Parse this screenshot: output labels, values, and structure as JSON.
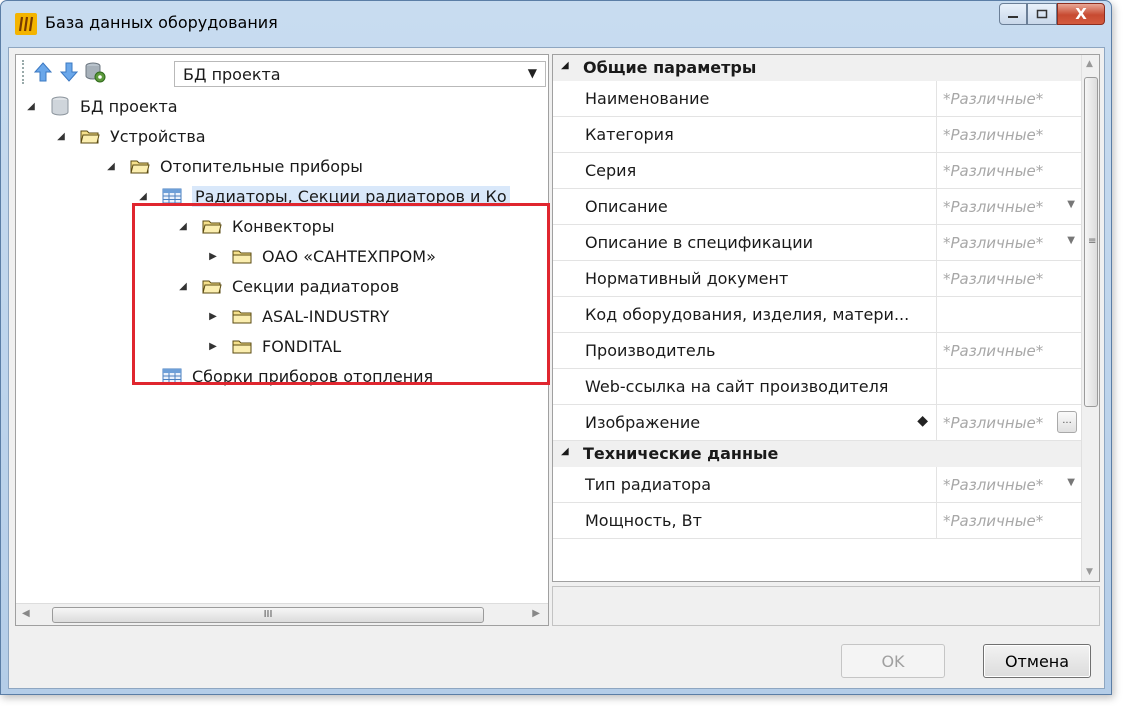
{
  "window": {
    "title": "База данных оборудования",
    "controls": {
      "minimize": "—",
      "maximize": "▢",
      "close": "X"
    }
  },
  "toolbar": {
    "icons": [
      "arrow-up-icon",
      "arrow-down-icon",
      "database-settings-icon"
    ],
    "source_combo": "БД проекта"
  },
  "tree": {
    "nodes": [
      {
        "label": "БД проекта",
        "icon": "database-icon",
        "expanded": true
      },
      {
        "label": "Устройства",
        "icon": "folder-open-icon",
        "expanded": true
      },
      {
        "label": "Отопительные приборы",
        "icon": "folder-open-icon",
        "expanded": true
      },
      {
        "label": "Радиаторы, Секции радиаторов и Ко",
        "icon": "table-icon",
        "expanded": true,
        "selected": true
      },
      {
        "label": "Конвекторы",
        "icon": "folder-open-icon",
        "expanded": true
      },
      {
        "label": "ОАО «САНТЕХПРОМ»",
        "icon": "folder-icon",
        "expanded": false
      },
      {
        "label": "Секции радиаторов",
        "icon": "folder-open-icon",
        "expanded": true
      },
      {
        "label": "ASAL-INDUSTRY",
        "icon": "folder-icon",
        "expanded": false
      },
      {
        "label": "FONDITAL",
        "icon": "folder-icon",
        "expanded": false
      },
      {
        "label": "Сборки приборов отопления",
        "icon": "table-icon",
        "expanded": false
      }
    ],
    "scroll_grip": "III"
  },
  "properties": {
    "categories": [
      {
        "label": "Общие параметры",
        "rows": [
          {
            "name": "Наименование",
            "value": "*Различные*"
          },
          {
            "name": "Категория",
            "value": "*Различные*"
          },
          {
            "name": "Серия",
            "value": "*Различные*"
          },
          {
            "name": "Описание",
            "value": "*Различные*",
            "dropdown": true
          },
          {
            "name": "Описание в спецификации",
            "value": "*Различные*",
            "dropdown": true
          },
          {
            "name": "Нормативный документ",
            "value": "*Различные*"
          },
          {
            "name": "Код оборудования, изделия, матери...",
            "value": ""
          },
          {
            "name": "Производитель",
            "value": "*Различные*"
          },
          {
            "name": "Web-ссылка на сайт производителя",
            "value": ""
          },
          {
            "name": "Изображение",
            "value": "*Различные*",
            "ellipsis": true,
            "diamond": true
          }
        ]
      },
      {
        "label": "Технические данные",
        "rows": [
          {
            "name": "Тип радиатора",
            "value": "*Различные*",
            "dropdown": true
          },
          {
            "name": "Мощность, Вт",
            "value": "*Различные*"
          }
        ]
      }
    ]
  },
  "buttons": {
    "ok": "OK",
    "cancel": "Отмена"
  },
  "colors": {
    "highlight_border": "#e0262f",
    "selected_row": "#d9e8fa",
    "placeholder_value": "#a8a8a8"
  }
}
